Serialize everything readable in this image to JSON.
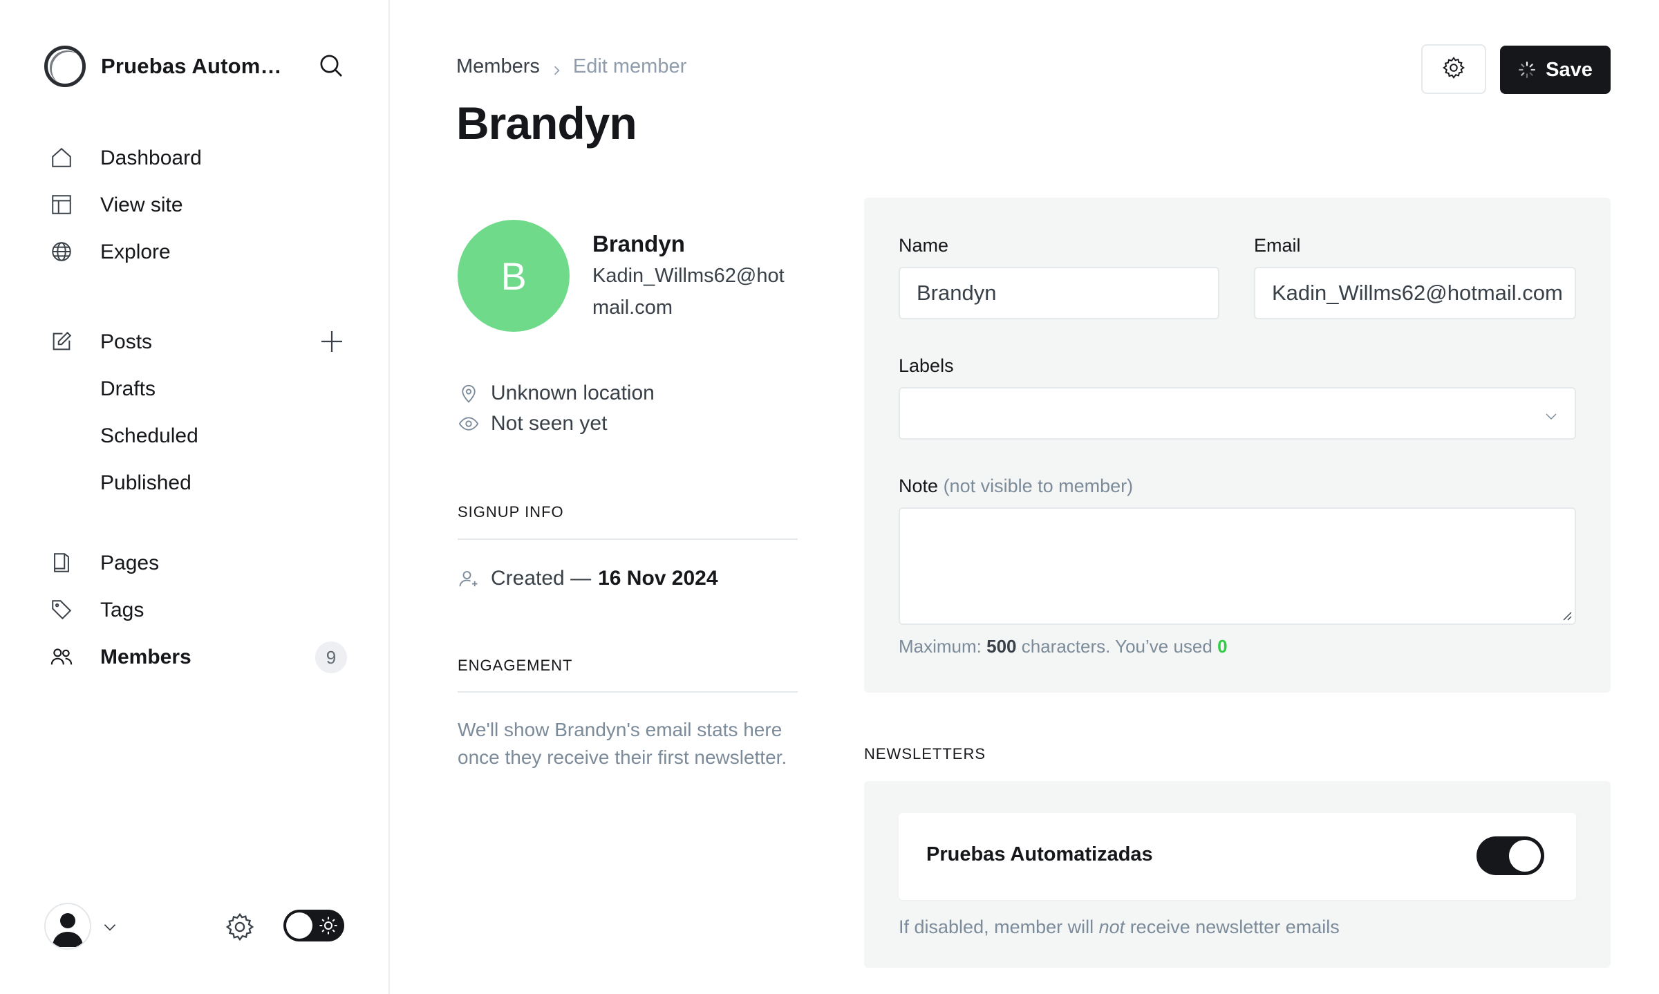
{
  "sidebar": {
    "site_title": "Pruebas Automatizadas",
    "nav": [
      {
        "label": "Dashboard",
        "icon": "home-icon"
      },
      {
        "label": "View site",
        "icon": "layout-icon"
      },
      {
        "label": "Explore",
        "icon": "globe-icon"
      }
    ],
    "posts": {
      "label": "Posts",
      "icon": "edit-icon"
    },
    "post_sub": [
      "Drafts",
      "Scheduled",
      "Published"
    ],
    "pages": {
      "label": "Pages",
      "icon": "pages-icon"
    },
    "tags": {
      "label": "Tags",
      "icon": "tag-icon"
    },
    "members": {
      "label": "Members",
      "icon": "members-icon",
      "count": "9"
    }
  },
  "header": {
    "breadcrumb_parent": "Members",
    "breadcrumb_current": "Edit member",
    "title": "Brandyn",
    "save_label": "Save"
  },
  "profile": {
    "initial": "B",
    "name": "Brandyn",
    "email": "Kadin_Willms62@hotmail.com",
    "location": "Unknown location",
    "last_seen": "Not seen yet",
    "avatar_color": "#6fdb8a"
  },
  "signup": {
    "heading": "SIGNUP INFO",
    "created_prefix": "Created —",
    "created_date": "16 Nov 2024"
  },
  "engagement": {
    "heading": "ENGAGEMENT",
    "text": "We'll show Brandyn's email stats here once they receive their first newsletter."
  },
  "form": {
    "name_label": "Name",
    "name_value": "Brandyn",
    "email_label": "Email",
    "email_value": "Kadin_Willms62@hotmail.com",
    "labels_label": "Labels",
    "note_label": "Note",
    "note_hint": "(not visible to member)",
    "note_value": "",
    "counter_prefix": "Maximum:",
    "counter_max": "500",
    "counter_middle": "characters. You’ve used",
    "counter_used": "0"
  },
  "newsletters": {
    "heading": "NEWSLETTERS",
    "items": [
      {
        "name": "Pruebas Automatizadas",
        "subscribed": true
      }
    ],
    "note_before": "If disabled, member will",
    "note_emph": "not",
    "note_after": "receive newsletter emails"
  },
  "colors": {
    "accent_dark": "#15171a",
    "success": "#30cf43"
  }
}
